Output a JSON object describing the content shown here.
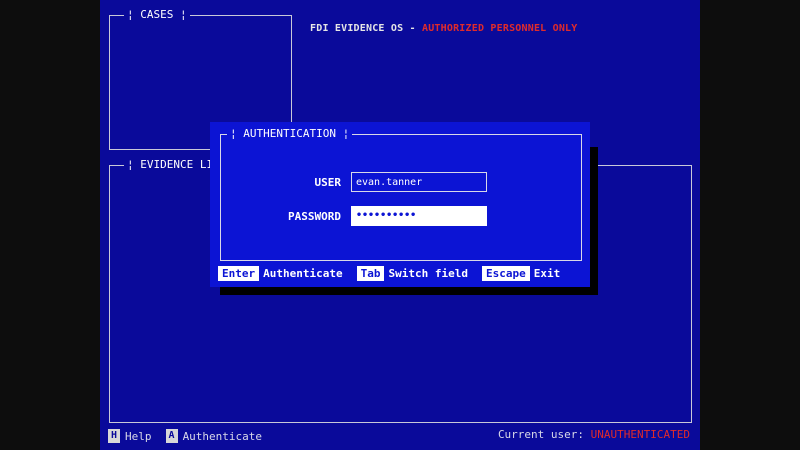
{
  "header": {
    "system_name": "FDI EVIDENCE OS",
    "separator": " - ",
    "warning": "AUTHORIZED PERSONNEL ONLY"
  },
  "panels": {
    "cases_title": "CASES",
    "evidence_list_title": "EVIDENCE LIS"
  },
  "dialog": {
    "title": "AUTHENTICATION",
    "user_label": "USER",
    "user_value": "evan.tanner",
    "password_label": "PASSWORD",
    "password_mask": "••••••••••",
    "hints": [
      {
        "key": "Enter",
        "action": "Authenticate"
      },
      {
        "key": "Tab",
        "action": "Switch field"
      },
      {
        "key": "Escape",
        "action": "Exit"
      }
    ]
  },
  "footer": {
    "shortcuts": [
      {
        "key": "H",
        "label": "Help"
      },
      {
        "key": "A",
        "label": "Authenticate"
      }
    ],
    "current_user_label": "Current user:",
    "current_user_status": "UNAUTHENTICATED"
  },
  "colors": {
    "screen_bg": "#0a0a9a",
    "dialog_bg": "#0c14d4",
    "warning": "#e02b2b",
    "text": "#ffffff"
  }
}
